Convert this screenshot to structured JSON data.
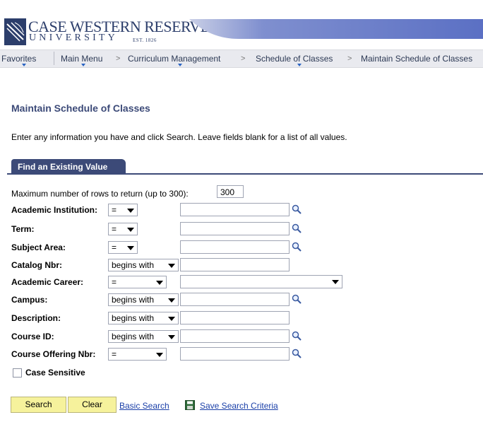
{
  "brand": {
    "name_line1": "CASE WESTERN RESERVE",
    "name_line2": "UNIVERSITY",
    "est": "EST. 1826"
  },
  "nav": {
    "items": [
      "Favorites",
      "Main Menu",
      "Curriculum Management",
      "Schedule of Classes",
      "Maintain Schedule of Classes"
    ],
    "separator": ">"
  },
  "page": {
    "title": "Maintain Schedule of Classes",
    "instructions": "Enter any information you have and click Search. Leave fields blank for a list of all values.",
    "tab_label": "Find an Existing Value"
  },
  "form": {
    "max_rows_label": "Maximum number of rows to return (up to 300):",
    "max_rows_value": "300",
    "fields": [
      {
        "label": "Academic Institution:",
        "operator": "=",
        "value": "",
        "lookup": true
      },
      {
        "label": "Term:",
        "operator": "=",
        "value": "",
        "lookup": true
      },
      {
        "label": "Subject Area:",
        "operator": "=",
        "value": "",
        "lookup": true
      },
      {
        "label": "Catalog Nbr:",
        "operator": "begins with",
        "value": "",
        "lookup": false
      },
      {
        "label": "Academic Career:",
        "operator": "=",
        "value": "",
        "lookup": false,
        "dropdown": true
      },
      {
        "label": "Campus:",
        "operator": "begins with",
        "value": "",
        "lookup": true
      },
      {
        "label": "Description:",
        "operator": "begins with",
        "value": "",
        "lookup": false
      },
      {
        "label": "Course ID:",
        "operator": "begins with",
        "value": "",
        "lookup": true
      },
      {
        "label": "Course Offering Nbr:",
        "operator": "=",
        "value": "",
        "lookup": true
      }
    ],
    "case_sensitive_label": "Case Sensitive",
    "case_sensitive_checked": false
  },
  "actions": {
    "search_label": "Search",
    "clear_label": "Clear",
    "basic_search_label": "Basic Search",
    "save_criteria_label": "Save Search Criteria"
  },
  "colors": {
    "brand_navy": "#2c3e6b",
    "tab_blue": "#3c4a78",
    "button_yellow": "#f6f29c",
    "link_blue": "#1a3fa8"
  },
  "icons": {
    "lookup": "magnifier-icon",
    "save": "floppy-disk-icon",
    "logo": "university-shield-icon"
  }
}
